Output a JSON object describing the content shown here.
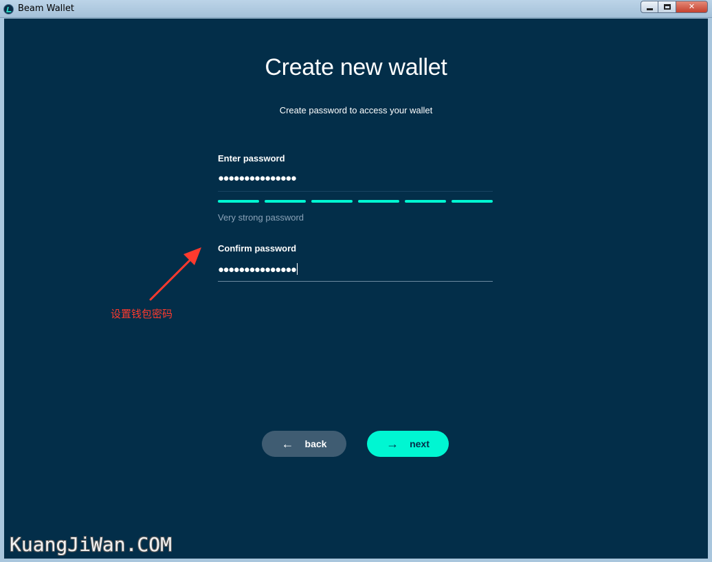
{
  "window": {
    "title": "Beam Wallet",
    "minimize_icon": "minimize-icon",
    "maximize_icon": "maximize-icon",
    "close_glyph": "✕"
  },
  "header": {
    "title": "Create new wallet",
    "subtitle": "Create password to access your wallet"
  },
  "form": {
    "enter_label": "Enter password",
    "enter_value": "●●●●●●●●●●●●●●●",
    "strength_segments_filled": 6,
    "strength_segments_total": 6,
    "strength_text": "Very strong password",
    "confirm_label": "Confirm password",
    "confirm_value": "●●●●●●●●●●●●●●●"
  },
  "buttons": {
    "back_label": "back",
    "back_icon": "←",
    "next_label": "next",
    "next_icon": "→"
  },
  "annotation": {
    "text": "设置钱包密码"
  },
  "watermark": {
    "text": "KuangJiWan.COM"
  },
  "colors": {
    "background": "#032e49",
    "accent": "#00f6d2",
    "annotation": "#ff3a2e",
    "back_button": "#3f5c72"
  }
}
